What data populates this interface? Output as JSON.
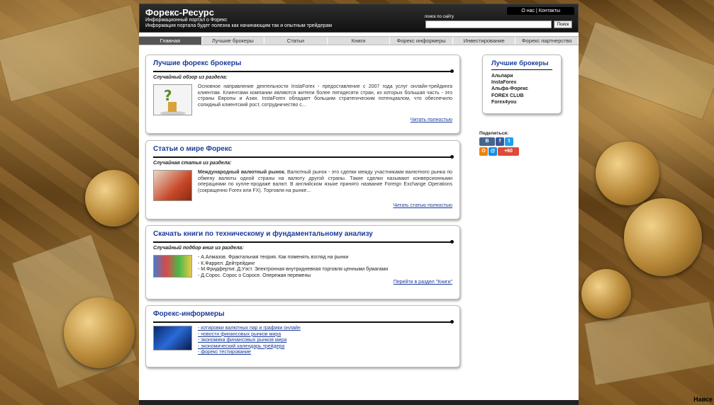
{
  "header": {
    "title": "Форекс-Ресурс",
    "subtitle1": "Информационный портал о Форекс",
    "subtitle2": "Информация портала будет полезна как начинающим так и опытным трейдерам",
    "top_links": "О нас | Контакты",
    "search_label": "поиск по сайту",
    "search_button": "Поиск"
  },
  "nav": [
    "Главная",
    "Лучшие брокеры",
    "Статьи",
    "Книги",
    "Форекс информеры",
    "Инвестирование",
    "Форекс партнерство"
  ],
  "boxes": {
    "brokers": {
      "title": "Лучшие форекс брокеры",
      "subtitle": "Случайный обзор из раздела:",
      "text": "Основное направление деятельности InstaForex - предоставление с 2007 года услуг онлайн-трейдинга клиентам. Клиентами компании являются жители более пятидесяти стран, из которых большая часть - это страны Европы и Азии. InstaForex обладает большим стратегическим потенциалом, что обеспечило солидный клиентский рост, сотрудничество с...",
      "more": "Читать полностью"
    },
    "articles": {
      "title": "Статьи о мире Форекс",
      "subtitle": "Случайная статья из раздела:",
      "text_bold": "Международный валютный рынок.",
      "text": " Валютный рынок - это сделки между участниками валютного рынка по обмену валюты одной страны на валюту другой страны. Такие сделки называют конверсионными операциями по купле-продаже валют. В английском языке принято название Foreign Exchange Operations (сокращенно Forex или FX). Торговля на рынке...",
      "more": "Читать статью полностью"
    },
    "books": {
      "title": "Скачать книги по техническому и фундаментальному анализу",
      "subtitle": "Случайный подбор книг из раздела:",
      "items": [
        "- А.Алмазов. Фрактальная теория. Как поменять взгляд на рынки",
        "- К.Фаррел. Дейтрейдинг",
        "- М.Фридфертиг. Д.Уэст. Электронная внутридневная торговля ценными бумагами",
        "- Д.Сорос. Сорос о Соросе. Опережая перемены"
      ],
      "more": "Перейти в раздел \"Книги\""
    },
    "informers": {
      "title": "Форекс-информеры",
      "items": [
        "- котировки валютных пар и графики онлайн",
        "- новости финансовых рынков мира",
        "- экономика финансовых рынков мира",
        "- экономический календарь трейдера",
        "- форекс тестирование"
      ]
    }
  },
  "sidebar": {
    "title": "Лучшие брокеры",
    "items": [
      "Альпари",
      "InstaForex",
      "Альфа-Форекс",
      "FOREX CLUB",
      "Forex4you"
    ],
    "share_label": "Поделиться:",
    "counter": "+60"
  },
  "corner_text": "Навсе",
  "colors": {
    "accent": "#1a3a99",
    "header_bg": "#1c1c1c",
    "nav_active": "#555555"
  }
}
